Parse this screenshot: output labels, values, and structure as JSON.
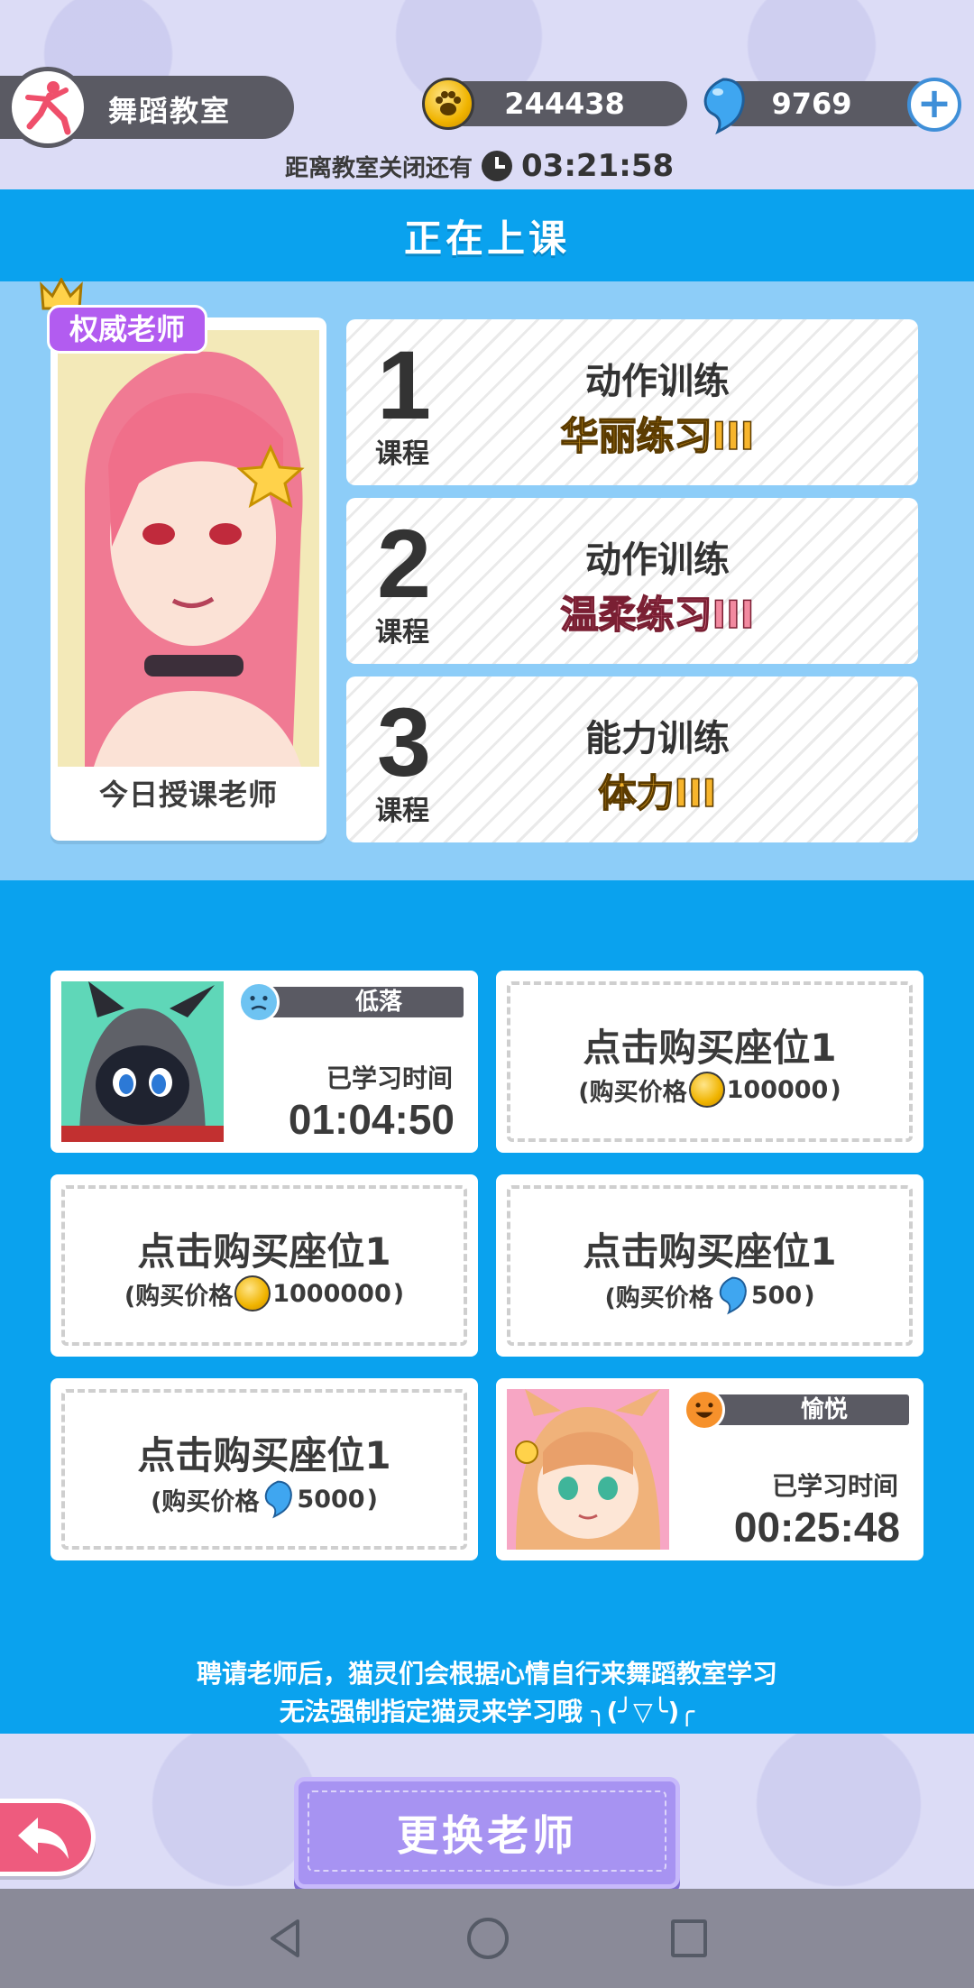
{
  "hud": {
    "room_name": "舞蹈教室",
    "coins": "244438",
    "gems": "9769",
    "countdown_label": "距离教室关闭还有",
    "countdown_time": "03:21:58"
  },
  "class_header": "正在上课",
  "teacher": {
    "badge": "权威老师",
    "caption": "今日授课老师"
  },
  "lessons": [
    {
      "number": "1",
      "sub": "课程",
      "title": "动作训练",
      "skill": "华丽练习III",
      "skill_color": "#f7b52c"
    },
    {
      "number": "2",
      "sub": "课程",
      "title": "动作训练",
      "skill": "温柔练习III",
      "skill_color": "#f28aa0"
    },
    {
      "number": "3",
      "sub": "课程",
      "title": "能力训练",
      "skill": "体力III",
      "skill_color": "#f7b52c"
    }
  ],
  "seats": {
    "s1": {
      "mood": "低落",
      "study_label": "已学习时间",
      "study_time": "01:04:50"
    },
    "s2": {
      "title": "点击购买座位1",
      "price_prefix": "(购买价格",
      "price": "100000",
      "price_suffix": ")",
      "currency": "coin"
    },
    "s3": {
      "title": "点击购买座位1",
      "price_prefix": "(购买价格",
      "price": "1000000",
      "price_suffix": ")",
      "currency": "coin"
    },
    "s4": {
      "title": "点击购买座位1",
      "price_prefix": "(购买价格",
      "price": "500",
      "price_suffix": ")",
      "currency": "gem"
    },
    "s5": {
      "title": "点击购买座位1",
      "price_prefix": "(购买价格",
      "price": "5000",
      "price_suffix": ")",
      "currency": "gem"
    },
    "s6": {
      "mood": "愉悦",
      "study_label": "已学习时间",
      "study_time": "00:25:48"
    }
  },
  "tip": {
    "line1": "聘请老师后，猫灵们会根据心情自行来舞蹈教室学习",
    "line2": "无法强制指定猫灵来学习哦 ╮(╯▽╰)╭"
  },
  "buttons": {
    "change_teacher": "更换老师"
  },
  "colors": {
    "header_blue": "#0aa2ee",
    "panel_blue": "#8dcdf8",
    "pill_gray": "#5a5a63",
    "badge_purple": "#b25cf0",
    "change_button": "#a793f2",
    "back_button": "#ee5b7e"
  }
}
